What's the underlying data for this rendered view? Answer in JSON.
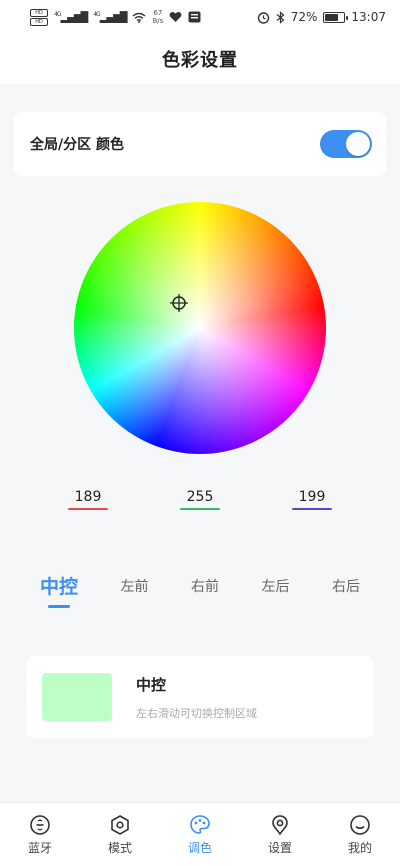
{
  "status_bar": {
    "hd_badge": "HD",
    "signal_type_1": "4G",
    "signal_type_2": "4G",
    "net_speed_value": "67",
    "net_speed_unit": "B/s",
    "battery_percent": "72%",
    "battery_level": 0.72,
    "time": "13:07"
  },
  "header": {
    "title": "色彩设置"
  },
  "zone_toggle": {
    "label": "全局/分区 颜色",
    "enabled": true
  },
  "color_picker": {
    "rgb": {
      "r": "189",
      "g": "255",
      "b": "199"
    },
    "r_color": "#e84a4a",
    "g_color": "#3cb56a",
    "b_color": "#5b47c6"
  },
  "zone_tabs": [
    {
      "label": "中控",
      "active": true
    },
    {
      "label": "左前",
      "active": false
    },
    {
      "label": "右前",
      "active": false
    },
    {
      "label": "左后",
      "active": false
    },
    {
      "label": "右后",
      "active": false
    }
  ],
  "zone_card": {
    "title": "中控",
    "hint": "左右滑动可切换控制区域",
    "swatch_color": "#bdffc7"
  },
  "bottom_nav": [
    {
      "label": "蓝牙",
      "icon": "bluetooth-icon",
      "active": false
    },
    {
      "label": "模式",
      "icon": "mode-icon",
      "active": false
    },
    {
      "label": "调色",
      "icon": "palette-icon",
      "active": true
    },
    {
      "label": "设置",
      "icon": "settings-icon",
      "active": false
    },
    {
      "label": "我的",
      "icon": "profile-icon",
      "active": false
    }
  ],
  "colors": {
    "accent": "#3d8ff2",
    "background": "#f6f7f9"
  }
}
